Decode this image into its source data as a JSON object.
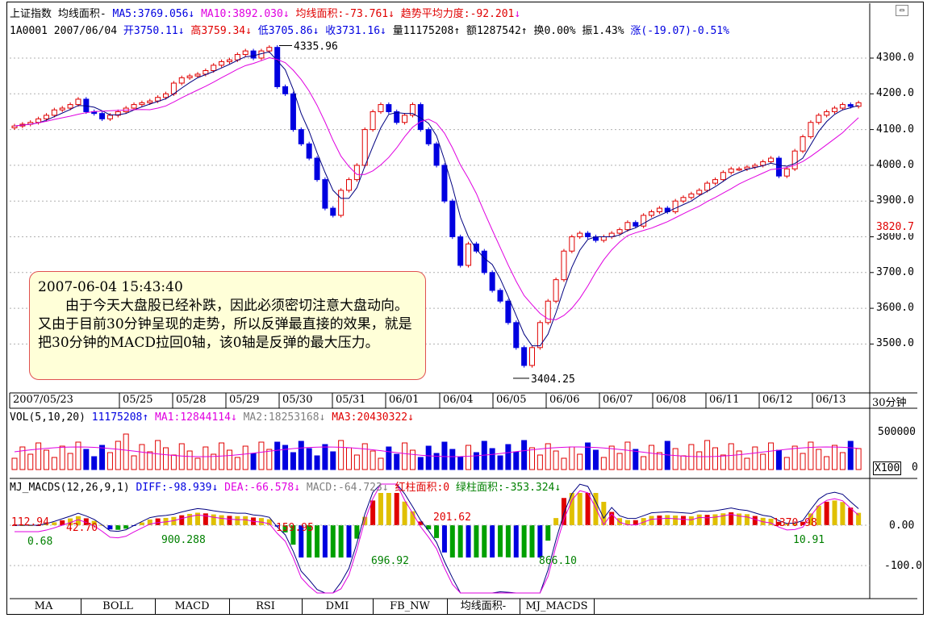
{
  "header1": {
    "index_name": "上证指数",
    "indicator": "均线面积-",
    "ma5": "MA5:3769.056",
    "ma10": "MA10:3892.030",
    "area": "均线面积:-73.761",
    "trend": "趋势平均力度:-92.201"
  },
  "header2": {
    "code_date": "1A0001 2007/06/04",
    "open": "开3750.11",
    "high": "高3759.34",
    "low": "低3705.86",
    "close": "收3731.16",
    "volume": "量11175208",
    "amount": "额1287542",
    "turnover": "换0.00%",
    "amplitude": "振1.43%",
    "change": "涨(-19.07)-0.51%"
  },
  "price_axis": [
    "4300.0",
    "4200.0",
    "4100.0",
    "4000.0",
    "3900.0",
    "3800.0",
    "3700.0",
    "3600.0",
    "3500.0"
  ],
  "current_price": "3820.7",
  "annotations": {
    "high": "4335.96",
    "low": "3404.25"
  },
  "date_axis": [
    "2007/05/23",
    "05/25",
    "05/28",
    "05/29",
    "05/30",
    "05/31",
    "06/01",
    "06/04",
    "06/05",
    "06/06",
    "06/07",
    "06/08",
    "06/11",
    "06/12",
    "06/13"
  ],
  "period": "30分钟",
  "note": {
    "timestamp": "2007-06-04 15:43:40",
    "text": "由于今天大盘股已经补跌，因此必须密切注意大盘动向。又由于目前30分钟呈现的走势，所以反弹最直接的效果，就是把30分钟的MACD拉回0轴，该0轴是反弹的最大压力。"
  },
  "vol_header": {
    "name": "VOL(5,10,20)",
    "vol": "11175208",
    "ma1": "MA1:12844114",
    "ma2": "MA2:18253168",
    "ma3": "MA3:20430322"
  },
  "vol_axis": {
    "top": "500000",
    "zero": "0",
    "unit": "X100"
  },
  "macd_header": {
    "name": "MJ_MACDS(12,26,9,1)",
    "diff": "DIFF:-98.939",
    "dea": "DEA:-66.578",
    "macd": "MACD:-64.723",
    "red_area": "红柱面积:0",
    "green_area": "绿柱面积:-353.324"
  },
  "macd_axis": [
    "0.00",
    "-100.0"
  ],
  "macd_labels": [
    "112.94",
    "0.68",
    "42.70",
    "900.288",
    "159.95",
    "696.92",
    "201.62",
    "866.10",
    "1370.98",
    "10.91"
  ],
  "tabs": [
    "MA",
    "BOLL",
    "MACD",
    "RSI",
    "DMI",
    "FB_NW",
    "均线面积-",
    "MJ_MACDS"
  ],
  "colors": {
    "up": "#e00000",
    "down": "#0000e0",
    "ma5": "#000080",
    "ma10": "#e000e0",
    "grid": "#b0b0b0"
  },
  "chart_data": {
    "type": "candlestick",
    "ylim": [
      3400,
      4350
    ],
    "candles_close_approx": [
      4110,
      4115,
      4120,
      4130,
      4140,
      4155,
      4160,
      4170,
      4185,
      4150,
      4145,
      4130,
      4140,
      4150,
      4160,
      4170,
      4175,
      4180,
      4190,
      4200,
      4230,
      4245,
      4250,
      4255,
      4265,
      4280,
      4290,
      4295,
      4310,
      4320,
      4300,
      4320,
      4330,
      4220,
      4200,
      4100,
      4060,
      4020,
      3960,
      3880,
      3860,
      3930,
      3960,
      4000,
      4100,
      4150,
      4170,
      4150,
      4120,
      4140,
      4170,
      4100,
      4060,
      4000,
      3900,
      3800,
      3720,
      3780,
      3760,
      3700,
      3650,
      3620,
      3560,
      3490,
      3440,
      3490,
      3560,
      3620,
      3680,
      3760,
      3800,
      3810,
      3800,
      3790,
      3800,
      3810,
      3820,
      3840,
      3830,
      3860,
      3870,
      3880,
      3870,
      3900,
      3910,
      3920,
      3930,
      3950,
      3960,
      3980,
      3990,
      3990,
      3995,
      4000,
      4010,
      4020,
      3970,
      3990,
      4040,
      4080,
      4120,
      4140,
      4150,
      4160,
      4170,
      4165,
      4175
    ]
  }
}
